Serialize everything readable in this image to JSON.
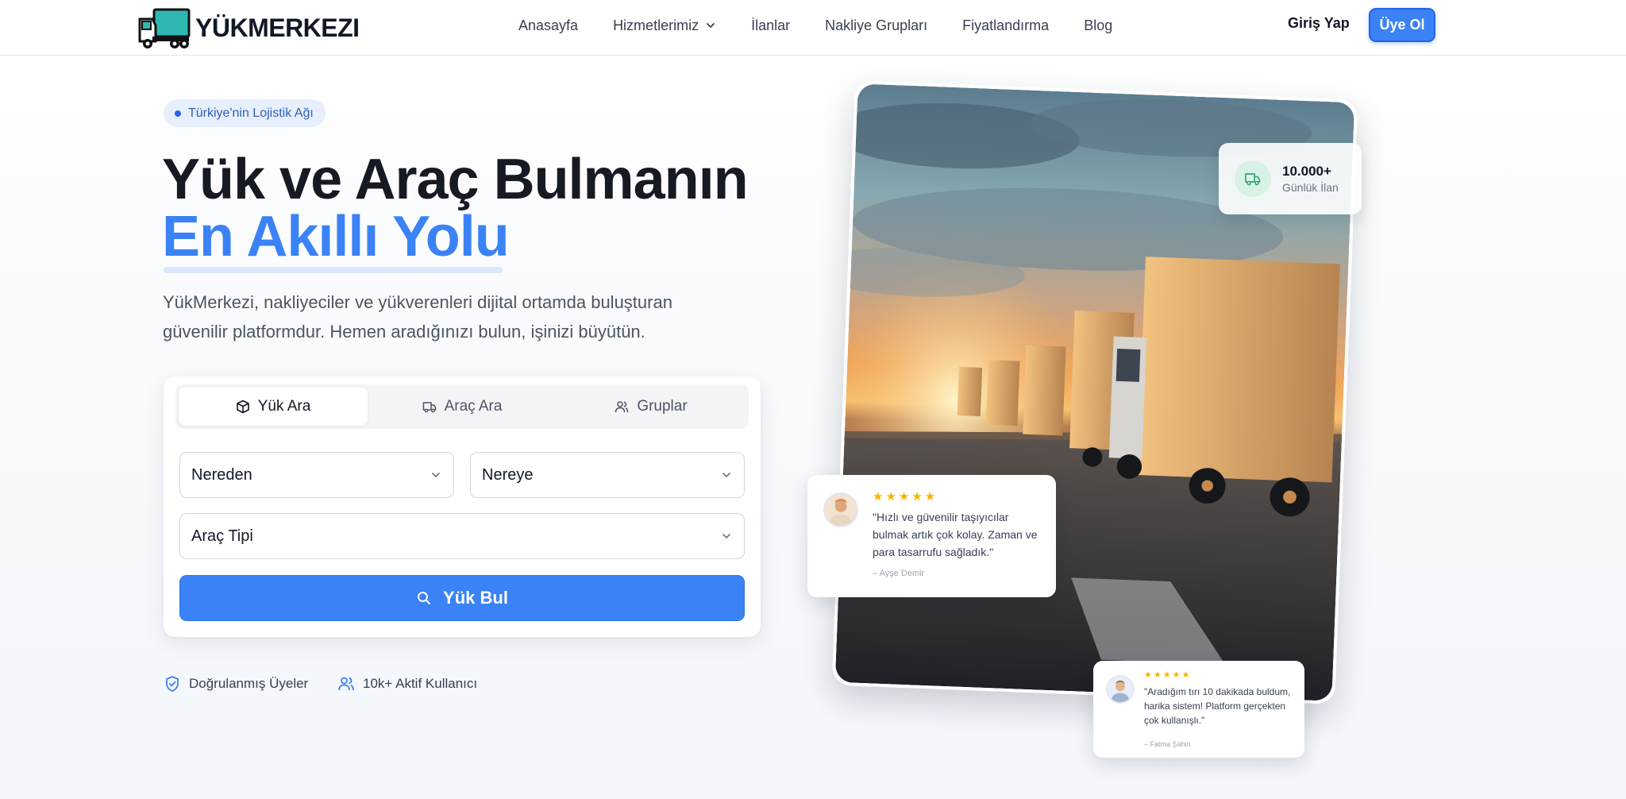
{
  "brand": {
    "name": "YÜKMERKEZI"
  },
  "nav": {
    "links": [
      "Anasayfa",
      "Hizmetlerimiz",
      "İlanlar",
      "Nakliye Grupları",
      "Fiyatlandırma",
      "Blog"
    ],
    "login": "Giriş Yap",
    "signup": "Üye Ol"
  },
  "hero": {
    "badge": "Türkiye'nin Lojistik Ağı",
    "title": "Yük ve Araç Bulmanın",
    "title_accent": "En Akıllı Yolu",
    "lead": "YükMerkezi, nakliyeciler ve yükverenleri dijital ortamda buluşturan güvenilir platformdur. Hemen aradığınızı bulun, işinizi büyütün."
  },
  "search": {
    "tabs": [
      "Yük Ara",
      "Araç Ara",
      "Gruplar"
    ],
    "active_tab": "Yük Ara",
    "from_placeholder": "Nereden",
    "to_placeholder": "Nereye",
    "vehicle_type": "Araç Tipi",
    "button": "Yük Bul"
  },
  "trust": [
    "Doğrulanmış Üyeler",
    "10k+ Aktif Kullanıcı"
  ],
  "stat": {
    "value": "10.000+",
    "label": "Günlük İlan"
  },
  "reviews": [
    {
      "rating": 5,
      "quote": "\"Hızlı ve güvenilir taşıyıcılar bulmak artık çok kolay. Zaman ve para tasarrufu sağladık.\"",
      "author": "– Ayşe Demir"
    },
    {
      "rating": 5,
      "quote": "\"Aradığım tırı 10 dakikada buldum, harika sistem! Platform gerçekten çok kullanışlı.\"",
      "author": "– Fatma Şahin"
    }
  ],
  "colors": {
    "primary": "#3b82f6",
    "text": "#151a23",
    "star": "#f5b400"
  }
}
